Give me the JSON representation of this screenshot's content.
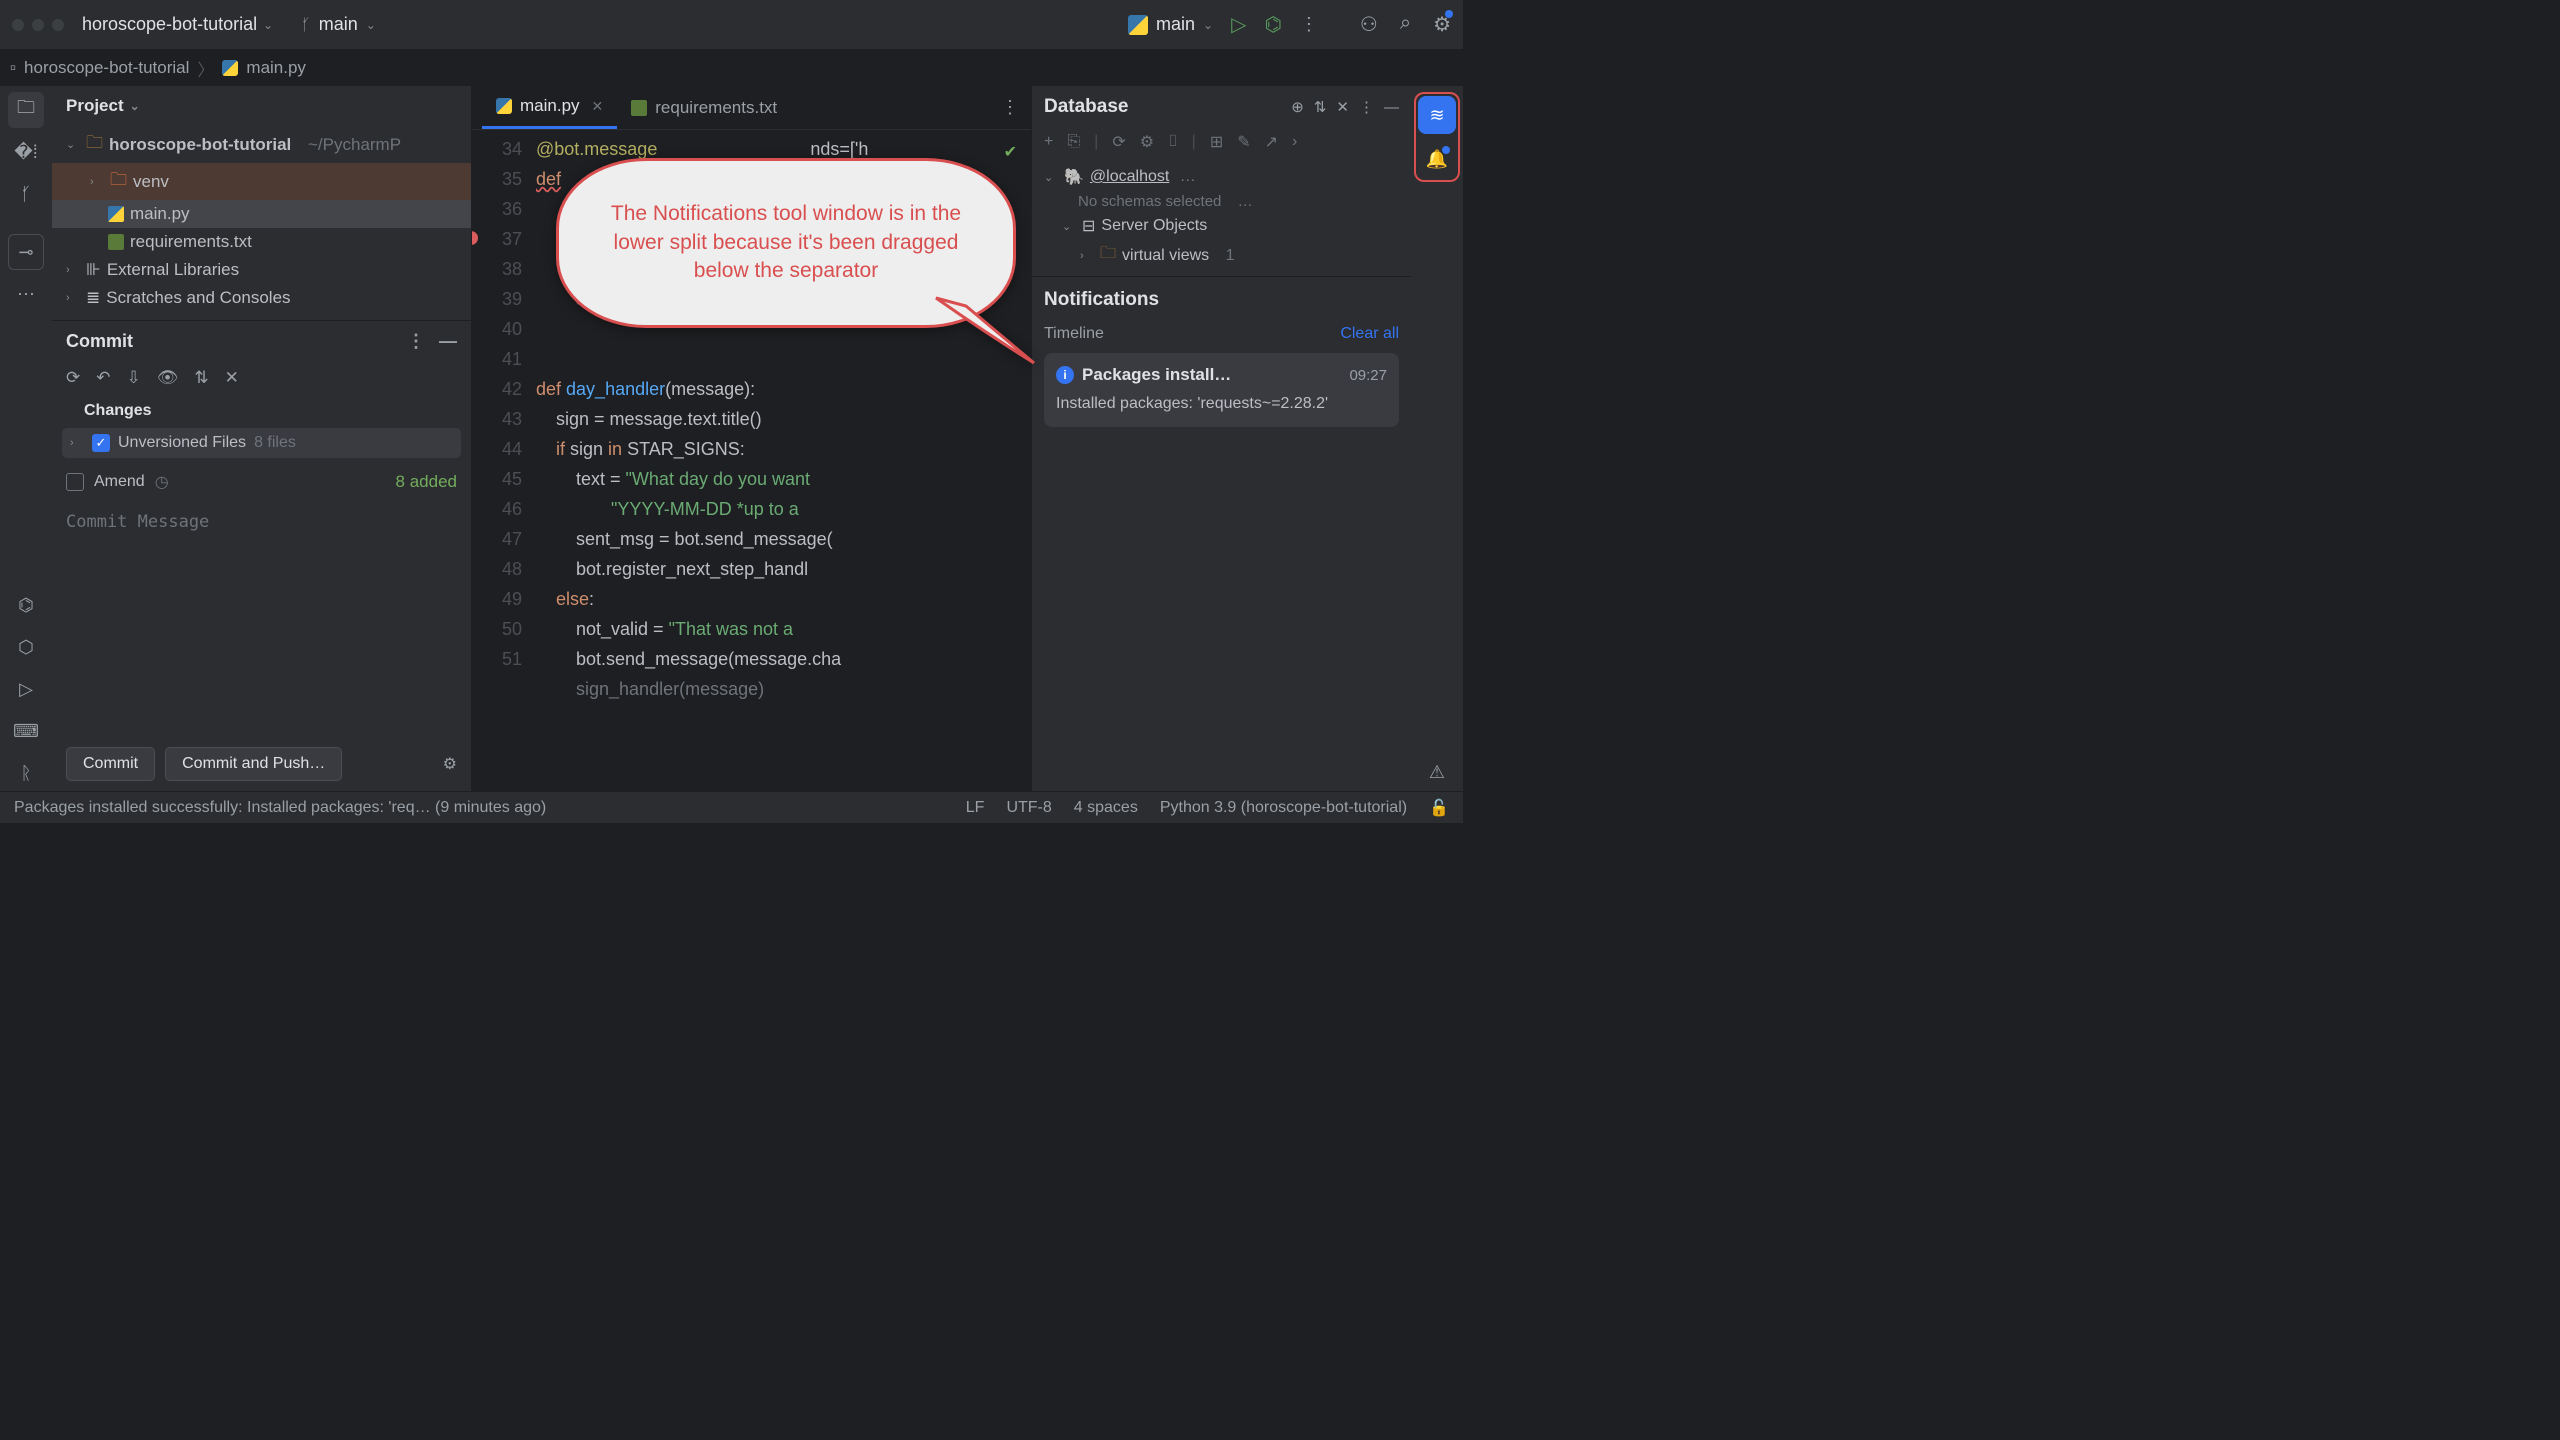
{
  "header": {
    "project": "horoscope-bot-tutorial",
    "branch": "main",
    "run_config": "main"
  },
  "breadcrumbs": {
    "root": "horoscope-bot-tutorial",
    "file": "main.py"
  },
  "project_panel": {
    "title": "Project",
    "root": "horoscope-bot-tutorial",
    "root_path": "~/PycharmP",
    "venv": "venv",
    "mainpy": "main.py",
    "reqs": "requirements.txt",
    "ext_lib": "External Libraries",
    "scratches": "Scratches and Consoles"
  },
  "commit": {
    "title": "Commit",
    "changes_label": "Changes",
    "unversioned": "Unversioned Files",
    "unversioned_count": "8 files",
    "amend": "Amend",
    "added": "8 added",
    "placeholder": "Commit Message",
    "btn_commit": "Commit",
    "btn_push": "Commit and Push…"
  },
  "tabs": {
    "main": "main.py",
    "reqs": "requirements.txt"
  },
  "code": {
    "lines": [
      "34",
      "35",
      "36",
      "37",
      "38",
      "39",
      "40",
      "41",
      "42",
      "43",
      "44",
      "45",
      "46",
      "47",
      "48",
      "49",
      "50",
      "51"
    ],
    "l34a": "@bot.message",
    "l34b": "nds=['h",
    "l35": "def",
    "l41a": "def ",
    "l41b": "day_handler",
    "l41c": "(message):",
    "l42": "    sign = message.text.title()",
    "l43a": "    ",
    "l43b": "if",
    "l43c": " sign ",
    "l43d": "in",
    "l43e": " STAR_SIGNS:",
    "l44a": "        text = ",
    "l44b": "\"What day do you want",
    "l45": "               \"YYYY-MM-DD *up to a ",
    "l46": "        sent_msg = bot.send_message(",
    "l47": "        bot.register_next_step_handl",
    "l48a": "    ",
    "l48b": "else",
    "l48c": ":",
    "l49a": "        not_valid = ",
    "l49b": "\"That was not a ",
    "l50": "        bot.send_message(message.cha",
    "l51": "        sign_handler(message)"
  },
  "database": {
    "title": "Database",
    "host": "@localhost",
    "no_schemas": "No schemas selected",
    "server_obj": "Server Objects",
    "virtual": "virtual views",
    "virtual_count": "1"
  },
  "notifications": {
    "title": "Notifications",
    "timeline": "Timeline",
    "clear": "Clear all",
    "card_title": "Packages install…",
    "card_time": "09:27",
    "card_body": "Installed packages: 'requests~=2.28.2'"
  },
  "status": {
    "msg": "Packages installed successfully: Installed packages: 'req… (9 minutes ago)",
    "lf": "LF",
    "enc": "UTF-8",
    "indent": "4 spaces",
    "interp": "Python 3.9 (horoscope-bot-tutorial)"
  },
  "callout": {
    "text": "The Notifications tool window is in the lower split because it's been dragged below the separator"
  }
}
